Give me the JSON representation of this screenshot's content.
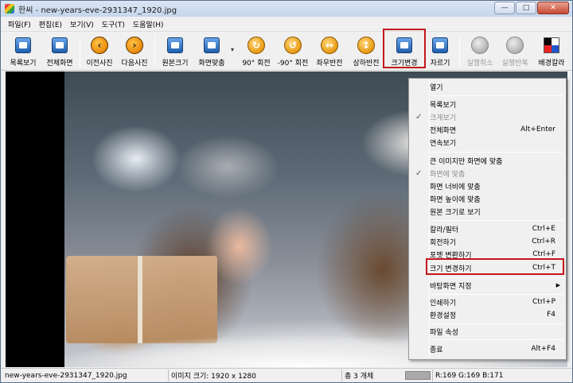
{
  "window": {
    "title": "한씨 - new-years-eve-2931347_1920.jpg",
    "minimize_glyph": "—",
    "maximize_glyph": "□",
    "close_glyph": "✕"
  },
  "menubar": {
    "items": [
      "파일(F)",
      "편집(E)",
      "보기(V)",
      "도구(T)",
      "도움말(H)"
    ]
  },
  "toolbar": {
    "items": [
      {
        "label": "목록보기",
        "icon": "list-view-icon"
      },
      {
        "label": "전체화면",
        "icon": "fullscreen-icon"
      },
      {
        "label": "이전사진",
        "icon": "previous-arrow-icon"
      },
      {
        "label": "다음사진",
        "icon": "next-arrow-icon"
      },
      {
        "label": "원본크기",
        "icon": "original-size-icon"
      },
      {
        "label": "화면맞춤",
        "icon": "fit-screen-icon"
      },
      {
        "label": "90° 회전",
        "icon": "rotate-cw-icon"
      },
      {
        "label": "-90° 회전",
        "icon": "rotate-ccw-icon"
      },
      {
        "label": "좌우반전",
        "icon": "flip-horizontal-icon"
      },
      {
        "label": "상하반전",
        "icon": "flip-vertical-icon"
      },
      {
        "label": "크기변경",
        "icon": "resize-icon"
      },
      {
        "label": "자르기",
        "icon": "crop-icon"
      },
      {
        "label": "실행취소",
        "icon": "undo-icon"
      },
      {
        "label": "실행반복",
        "icon": "redo-icon"
      },
      {
        "label": "배경칼라",
        "icon": "background-color-icon"
      }
    ],
    "fit_dropdown_glyph": "▾",
    "nav_prev_glyph": "‹",
    "nav_next_glyph": "›",
    "rotate_cw_glyph": "↻",
    "rotate_ccw_glyph": "↺",
    "flip_h_glyph": "↔",
    "flip_v_glyph": "↕"
  },
  "context_menu": {
    "items": [
      {
        "label": "열기",
        "shortcut": ""
      },
      {
        "label": "목록보기",
        "shortcut": ""
      },
      {
        "label": "크게보기",
        "shortcut": "",
        "checked": true,
        "disabled": true
      },
      {
        "label": "전체화면",
        "shortcut": "Alt+Enter"
      },
      {
        "label": "연속보기",
        "shortcut": ""
      },
      {
        "label": "큰 이미지만 화면에 맞춤",
        "shortcut": ""
      },
      {
        "label": "화면에 맞춤",
        "shortcut": "",
        "checked": true,
        "disabled": true
      },
      {
        "label": "화면 너비에 맞춤",
        "shortcut": ""
      },
      {
        "label": "화면 높이에 맞춤",
        "shortcut": ""
      },
      {
        "label": "원본 크기로 보기",
        "shortcut": ""
      },
      {
        "label": "칼라/필터",
        "shortcut": "Ctrl+E"
      },
      {
        "label": "회전하기",
        "shortcut": "Ctrl+R"
      },
      {
        "label": "포멧 변환하기",
        "shortcut": "Ctrl+F"
      },
      {
        "label": "크기 변경하기",
        "shortcut": "Ctrl+T"
      },
      {
        "label": "바탕화면 지정",
        "shortcut": "",
        "submenu": true
      },
      {
        "label": "인쇄하기",
        "shortcut": "Ctrl+P"
      },
      {
        "label": "환경설정",
        "shortcut": "F4"
      },
      {
        "label": "파일 속성",
        "shortcut": ""
      },
      {
        "label": "종료",
        "shortcut": "Alt+F4"
      }
    ],
    "check_glyph": "✓",
    "submenu_glyph": "▶"
  },
  "statusbar": {
    "filename": "new-years-eve-2931347_1920.jpg",
    "image_size": "이미지 크기: 1920 x 1280",
    "count": "총 3 개체",
    "pixel_color": "R:169 G:169 B:171",
    "swatch_color": "#a9a9ab"
  },
  "colors": {
    "highlight_border": "#c4161c",
    "titlebar": "#c5d6ec"
  }
}
